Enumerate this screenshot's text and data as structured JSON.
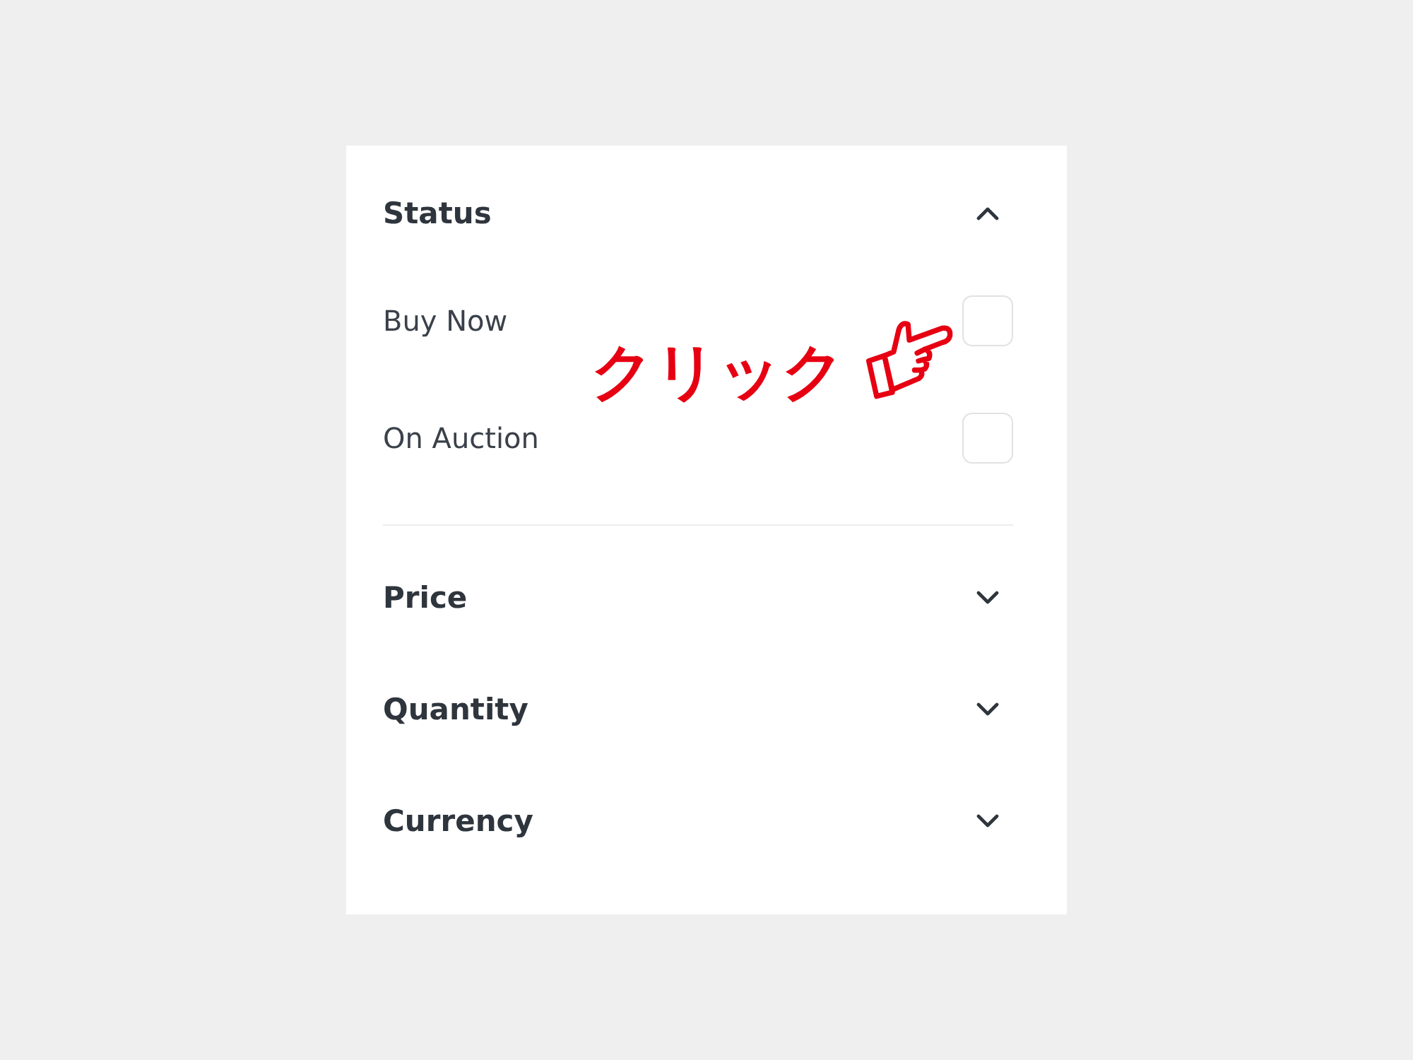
{
  "filter_panel": {
    "sections": [
      {
        "title": "Status",
        "expanded": true,
        "options": [
          {
            "label": "Buy Now",
            "checked": false
          },
          {
            "label": "On Auction",
            "checked": false
          }
        ]
      },
      {
        "title": "Price",
        "expanded": false
      },
      {
        "title": "Quantity",
        "expanded": false
      },
      {
        "title": "Currency",
        "expanded": false
      }
    ]
  },
  "annotation": {
    "text": "クリック"
  }
}
